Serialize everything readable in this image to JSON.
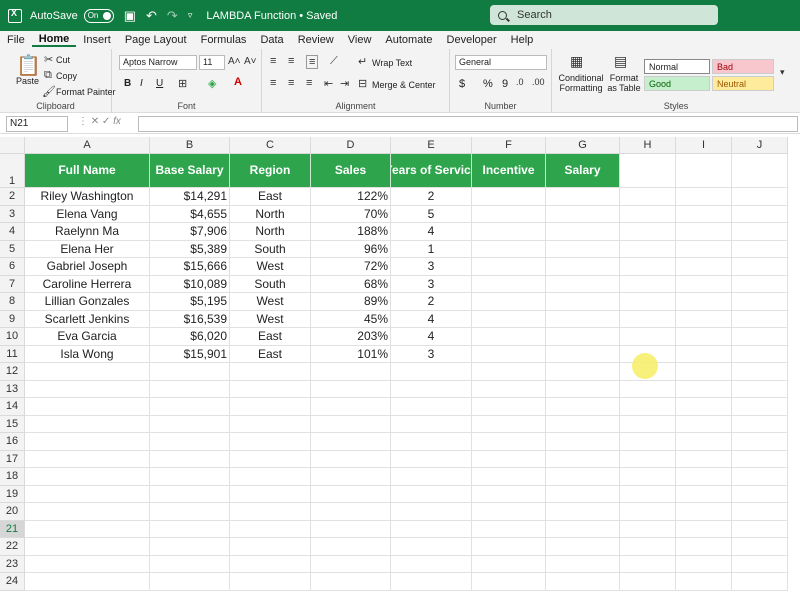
{
  "titlebar": {
    "autosave_label": "AutoSave",
    "toggle_label": "On",
    "doc_title": "LAMBDA Function • Saved",
    "search_placeholder": "Search"
  },
  "menu": [
    "File",
    "Home",
    "Insert",
    "Page Layout",
    "Formulas",
    "Data",
    "Review",
    "View",
    "Automate",
    "Developer",
    "Help"
  ],
  "ribbon": {
    "clipboard": {
      "paste": "Paste",
      "cut": "Cut",
      "copy": "Copy",
      "format_painter": "Format Painter",
      "label": "Clipboard"
    },
    "font": {
      "name": "Aptos Narrow",
      "size": "11",
      "bold": "B",
      "italic": "I",
      "underline": "U",
      "label": "Font"
    },
    "alignment": {
      "wrap_text": "Wrap Text",
      "merge_center": "Merge & Center",
      "label": "Alignment"
    },
    "number": {
      "format": "General",
      "currency": "$",
      "percent": "%",
      "comma": "9",
      "label": "Number"
    },
    "styles": {
      "conditional": "Conditional Formatting",
      "format_table": "Format as Table",
      "normal": "Normal",
      "bad": "Bad",
      "good": "Good",
      "neutral": "Neutral",
      "label": "Styles"
    }
  },
  "formula_bar": {
    "name_box": "N21",
    "formula": ""
  },
  "columns": [
    "A",
    "B",
    "C",
    "D",
    "E",
    "F",
    "G",
    "H",
    "I",
    "J"
  ],
  "rows": [
    "1",
    "2",
    "3",
    "4",
    "5",
    "6",
    "7",
    "8",
    "9",
    "10",
    "11",
    "12",
    "13",
    "14",
    "15",
    "16",
    "17",
    "18",
    "19",
    "20",
    "21",
    "22",
    "23",
    "24"
  ],
  "table": {
    "headers": [
      "Full Name",
      "Base Salary",
      "Region",
      "Sales",
      "Years of Service",
      "Incentive",
      "Salary"
    ],
    "data": [
      [
        "Riley Washington",
        "$14,291",
        "East",
        "122%",
        "2",
        "",
        ""
      ],
      [
        "Elena Vang",
        "$4,655",
        "North",
        "70%",
        "5",
        "",
        ""
      ],
      [
        "Raelynn Ma",
        "$7,906",
        "North",
        "188%",
        "4",
        "",
        ""
      ],
      [
        "Elena Her",
        "$5,389",
        "South",
        "96%",
        "1",
        "",
        ""
      ],
      [
        "Gabriel Joseph",
        "$15,666",
        "West",
        "72%",
        "3",
        "",
        ""
      ],
      [
        "Caroline Herrera",
        "$10,089",
        "South",
        "68%",
        "3",
        "",
        ""
      ],
      [
        "Lillian Gonzales",
        "$5,195",
        "West",
        "89%",
        "2",
        "",
        ""
      ],
      [
        "Scarlett Jenkins",
        "$16,539",
        "West",
        "45%",
        "4",
        "",
        ""
      ],
      [
        "Eva Garcia",
        "$6,020",
        "East",
        "203%",
        "4",
        "",
        ""
      ],
      [
        "Isla Wong",
        "$15,901",
        "East",
        "101%",
        "3",
        "",
        ""
      ]
    ]
  },
  "colors": {
    "excel_green": "#107c41",
    "header_fill": "#2ea54c"
  }
}
